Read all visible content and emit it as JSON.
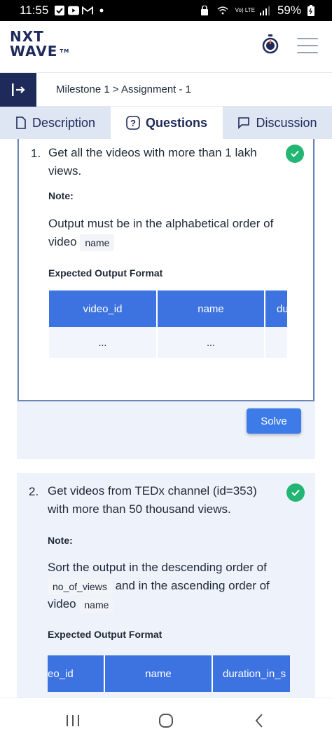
{
  "status_bar": {
    "time": "11:55",
    "battery": "59%",
    "network": "Vo) LTE",
    "icons": [
      "check-box-icon",
      "youtube-icon",
      "gmail-icon",
      "dot-icon",
      "lock-icon",
      "wifi-icon",
      "signal-icon",
      "battery-icon"
    ]
  },
  "header": {
    "logo_line1": "NXT",
    "logo_line2": "WAVE",
    "logo_tm": "TM",
    "icons": [
      "timer-icon",
      "hamburger-menu-icon"
    ]
  },
  "breadcrumb": "Milestone 1 > Assignment - 1",
  "tabs": [
    {
      "label": "Description",
      "icon": "document-icon",
      "active": false
    },
    {
      "label": "Questions",
      "icon": "question-icon",
      "active": true
    },
    {
      "label": "Discussion",
      "icon": "chat-icon",
      "active": false
    }
  ],
  "questions": [
    {
      "number": "1.",
      "title": "Get all the videos with more than 1 lakh views.",
      "completed": true,
      "note_label": "Note:",
      "note_text_before": "Output must be in the alphabetical order of video",
      "note_code1": "name",
      "eof_label": "Expected Output Format",
      "columns": [
        "video_id",
        "name",
        "du"
      ],
      "row": [
        "...",
        "...",
        ""
      ],
      "solve_label": "Solve"
    },
    {
      "number": "2.",
      "title": "Get videos from TEDx channel (id=353) with more than 50 thousand views.",
      "completed": true,
      "note_label": "Note:",
      "note_text_part1": "Sort the output in the descending order of",
      "note_code1": "no_of_views",
      "note_text_part2": "and in the ascending order of video",
      "note_code2": "name",
      "eof_label": "Expected Output Format",
      "columns": [
        "eo_id",
        "name",
        "duration_in_s"
      ]
    }
  ],
  "colors": {
    "brand_navy": "#1e2a5a",
    "table_header_blue": "#3d73e0",
    "solve_button": "#3d7ce8",
    "check_green": "#22b573",
    "tab_inactive": "#dfe6f3"
  }
}
